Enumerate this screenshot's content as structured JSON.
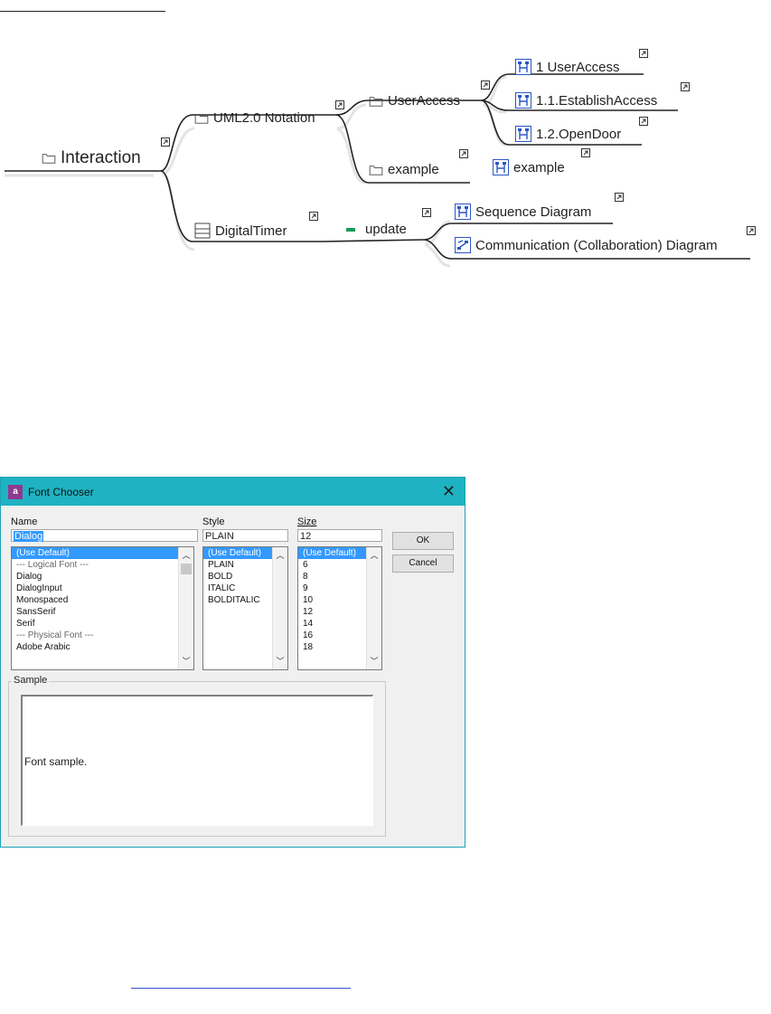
{
  "mindmap": {
    "root": "Interaction",
    "uml": "UML2.0 Notation",
    "useraccess": "UserAccess",
    "ua1": "1 UserAccess",
    "ua2": "1.1.EstablishAccess",
    "ua3": "1.2.OpenDoor",
    "example_folder": "example",
    "example_diagram": "example",
    "digitaltimer": "DigitalTimer",
    "update": "update",
    "seq": "Sequence Diagram",
    "comm": "Communication (Collaboration) Diagram"
  },
  "dialog": {
    "title": "Font Chooser",
    "close": "✕",
    "app_icon_text": "a",
    "name_label": "Name",
    "name_value": "Dialog",
    "style_label": "Style",
    "style_value": "PLAIN",
    "size_label": "Size",
    "size_value": "12",
    "name_items": [
      "(Use Default)",
      "--- Logical Font ---",
      "Dialog",
      "DialogInput",
      "Monospaced",
      "SansSerif",
      "Serif",
      "--- Physical Font ---",
      "Adobe Arabic"
    ],
    "style_items": [
      "(Use Default)",
      "PLAIN",
      "BOLD",
      "ITALIC",
      "BOLDITALIC"
    ],
    "size_items": [
      "(Use Default)",
      "6",
      "8",
      "9",
      "10",
      "12",
      "14",
      "16",
      "18"
    ],
    "ok": "OK",
    "cancel": "Cancel",
    "sample_label": "Sample",
    "sample_text": "Font sample."
  },
  "colors": {
    "titlebar": "#1fb2c2",
    "selection": "#3399ff",
    "diagram_icon": "#2a56c6",
    "update_marker": "#1a9a5a"
  }
}
